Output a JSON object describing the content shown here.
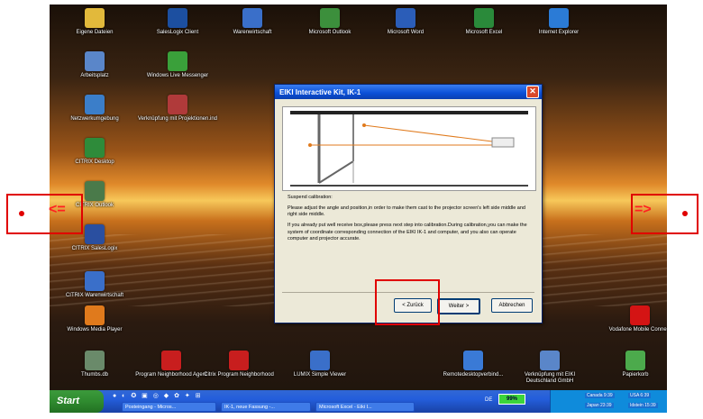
{
  "desktop": {
    "icons": [
      {
        "label": "Eigene Dateien",
        "color": "#e2b93b"
      },
      {
        "label": "SalesLogix Client",
        "color": "#1c4fa0"
      },
      {
        "label": "Warenwirtschaft",
        "color": "#3a6fc9"
      },
      {
        "label": "Microsoft Outlook",
        "color": "#3c8f3c"
      },
      {
        "label": "Microsoft Word",
        "color": "#2b5db8"
      },
      {
        "label": "Microsoft Excel",
        "color": "#2a8a3a"
      },
      {
        "label": "Internet Explorer",
        "color": "#2b7bd6"
      },
      {
        "label": "Arbeitsplatz",
        "color": "#5a86c9"
      },
      {
        "label": "Windows Live Messenger",
        "color": "#3aa03a"
      },
      {
        "label": "Netzwerkumgebung",
        "color": "#3b7ec9"
      },
      {
        "label": "Verknüpfung mit Projektionen.ind",
        "color": "#b03a3a"
      },
      {
        "label": "CITRIX Desktop",
        "color": "#2e8b3a"
      },
      {
        "label": "CITRIX Outlook",
        "color": "#4a7a4a"
      },
      {
        "label": "CITRIX SalesLogix",
        "color": "#2a4fa0"
      },
      {
        "label": "CITRIX Warenwirtschaft",
        "color": "#3a6fc9"
      },
      {
        "label": "Windows Media Player",
        "color": "#e07a1c"
      },
      {
        "label": "Vodafone Mobile Connect",
        "color": "#d41414"
      },
      {
        "label": "Thumbs.db",
        "color": "#6a8a6a"
      },
      {
        "label": "Program Neighborhood Agent",
        "color": "#c81e1e"
      },
      {
        "label": "Citrix Program Neighborhood",
        "color": "#c81e1e"
      },
      {
        "label": "LUMIX Simple Viewer",
        "color": "#3a6fc9"
      },
      {
        "label": "Remotedesktopverbind...",
        "color": "#3a7ad6"
      },
      {
        "label": "Verknüpfung mit EIKI Deutschland GmbH",
        "color": "#5a86c9"
      },
      {
        "label": "Papierkorb",
        "color": "#4caa4c"
      }
    ]
  },
  "dialog": {
    "title": "EIKI Interactive Kit, IK-1",
    "close_glyph": "✕",
    "heading": "Suspend calibration:",
    "para1": "Please adjust the angle and position,in order to make them cast to the projector screen's left side middle and right side middle.",
    "para2": "If you already put well receive box,please press next step into calibration.During calibration,you can make the",
    "para3": "system of coordinate corresponding connection of the EIKI IK-1 and computer, and you also can operate computer and projector accurate.",
    "back_label": "< Zurück",
    "next_label": "Weiter >",
    "cancel_label": "Abbrechen"
  },
  "taskbar": {
    "start_label": "Start",
    "quicklaunch": "● ◐ ✪ ▣ ◎ ◆ ✿ ✦ ⊞",
    "tasks": [
      "Posteingang - Micros...",
      "IK-1, neue Fassung -...",
      "Microsoft Excel - Eiki I..."
    ],
    "lang": "DE",
    "battery": "99%",
    "clocks": [
      "Canada 9:39",
      "USA 6:39",
      "Japan 23:39",
      "Idstein 15:39"
    ]
  },
  "overlay": {
    "left_arrow": "<=",
    "right_arrow": "=>"
  }
}
